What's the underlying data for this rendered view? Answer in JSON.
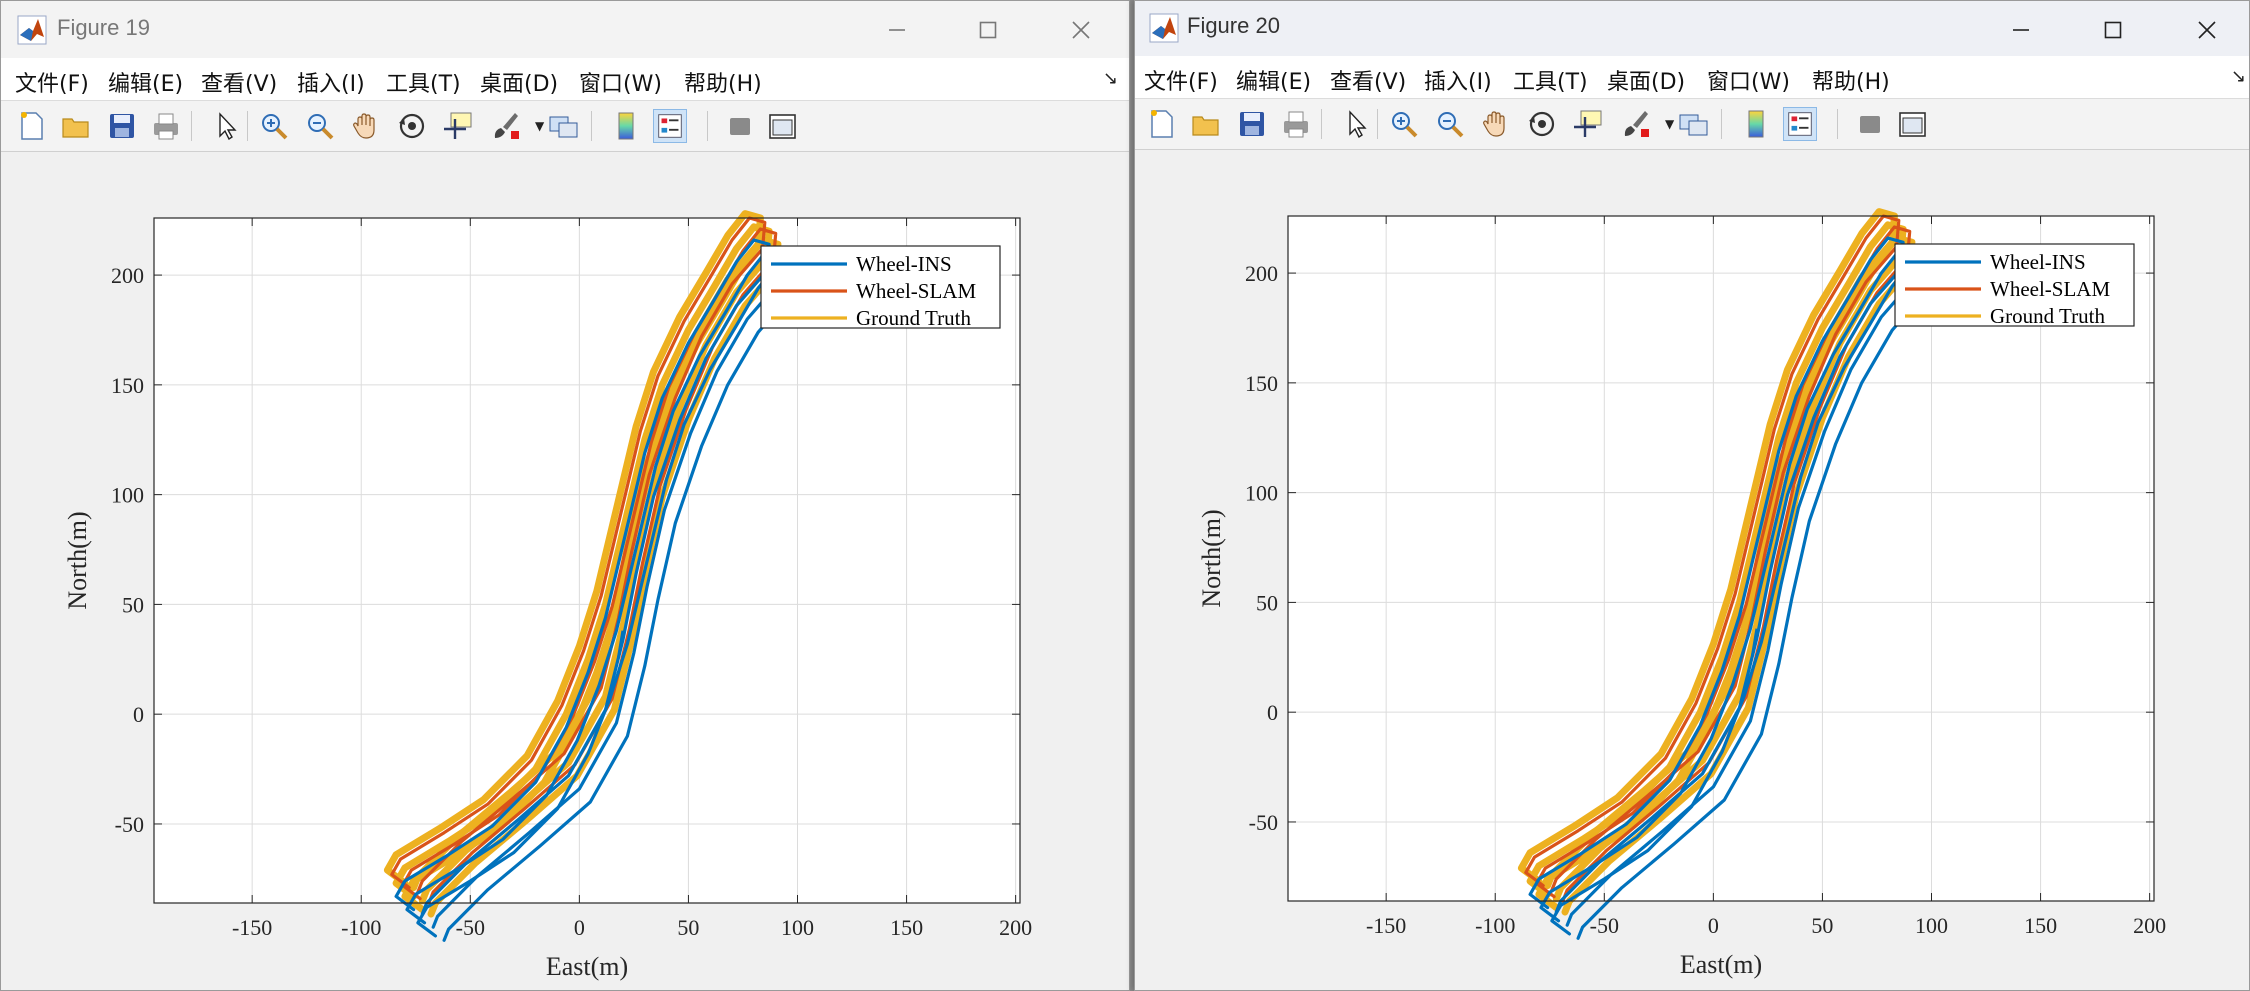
{
  "windows": [
    {
      "title": "Figure 19",
      "menu": [
        "文件(F)",
        "编辑(E)",
        "查看(V)",
        "插入(I)",
        "工具(T)",
        "桌面(D)",
        "窗口(W)",
        "帮助(H)"
      ]
    },
    {
      "title": "Figure 20",
      "menu": [
        "文件(F)",
        "编辑(E)",
        "查看(V)",
        "插入(I)",
        "工具(T)",
        "桌面(D)",
        "窗口(W)",
        "帮助(H)"
      ]
    }
  ],
  "toolbar_icons": [
    "new-figure-icon",
    "open-file-icon",
    "save-icon",
    "print-icon",
    "pointer-icon",
    "zoom-in-icon",
    "zoom-out-icon",
    "pan-icon",
    "rotate-3d-icon",
    "data-cursor-icon",
    "brush-icon",
    "link-plot-icon",
    "colorbar-icon",
    "legend-icon",
    "hide-plot-tools-icon",
    "show-plot-tools-icon"
  ],
  "colors": {
    "wheel_ins": "#0072BD",
    "wheel_slam": "#D95319",
    "ground_truth": "#EDB120"
  },
  "chart_data": [
    {
      "type": "line",
      "title": "",
      "xlabel": "East(m)",
      "ylabel": "North(m)",
      "xlim": [
        -195,
        202
      ],
      "ylim": [
        -86,
        226
      ],
      "xticks": [
        -150,
        -100,
        -50,
        0,
        50,
        100,
        150,
        200
      ],
      "yticks": [
        -50,
        0,
        50,
        100,
        150,
        200
      ],
      "xtick_labels": [
        "-150",
        "-100",
        "-50",
        "0",
        "50",
        "100",
        "150",
        "200"
      ],
      "ytick_labels": [
        "-50",
        "0",
        "50",
        "100",
        "150",
        "200"
      ],
      "grid": true,
      "legend_position": "top-right",
      "series": [
        {
          "name": "Wheel-INS",
          "color": "#0072BD",
          "loops": [
            [
              0,
              -6
            ],
            [
              5,
              -12
            ],
            [
              10,
              -18
            ]
          ],
          "start": [
            20,
            38
          ]
        },
        {
          "name": "Wheel-SLAM",
          "color": "#D95319",
          "loops": [
            [
              -2,
              4
            ],
            [
              3,
              -1
            ]
          ],
          "start": null
        },
        {
          "name": "Ground Truth",
          "color": "#EDB120",
          "loops": [
            [
              -4,
              6
            ],
            [
              0,
              0
            ],
            [
              4,
              -6
            ]
          ],
          "start": null
        }
      ],
      "path": [
        [
          -76,
          -83
        ],
        [
          -84,
          -77
        ],
        [
          -80,
          -70
        ],
        [
          -60,
          -58
        ],
        [
          -40,
          -45
        ],
        [
          -20,
          -25
        ],
        [
          -6,
          0
        ],
        [
          4,
          25
        ],
        [
          12,
          50
        ],
        [
          18,
          75
        ],
        [
          24,
          100
        ],
        [
          30,
          125
        ],
        [
          38,
          150
        ],
        [
          50,
          175
        ],
        [
          62,
          195
        ],
        [
          72,
          212
        ],
        [
          80,
          222
        ],
        [
          87,
          220
        ],
        [
          86,
          208
        ],
        [
          72,
          192
        ],
        [
          58,
          168
        ],
        [
          46,
          140
        ],
        [
          34,
          105
        ],
        [
          26,
          70
        ],
        [
          20,
          40
        ],
        [
          12,
          8
        ],
        [
          -5,
          -22
        ],
        [
          -28,
          -42
        ],
        [
          -52,
          -62
        ],
        [
          -70,
          -80
        ],
        [
          -72,
          -85
        ]
      ]
    },
    {
      "type": "line",
      "title": "",
      "xlabel": "East(m)",
      "ylabel": "North(m)",
      "xlim": [
        -195,
        202
      ],
      "ylim": [
        -86,
        226
      ],
      "xticks": [
        -150,
        -100,
        -50,
        0,
        50,
        100,
        150,
        200
      ],
      "yticks": [
        -50,
        0,
        50,
        100,
        150,
        200
      ],
      "xtick_labels": [
        "-150",
        "-100",
        "-50",
        "0",
        "50",
        "100",
        "150",
        "200"
      ],
      "ytick_labels": [
        "-50",
        "0",
        "50",
        "100",
        "150",
        "200"
      ],
      "grid": true,
      "legend_position": "top-right",
      "series": [
        {
          "name": "Wheel-INS",
          "color": "#0072BD",
          "loops": [
            [
              0,
              -6
            ],
            [
              5,
              -12
            ],
            [
              10,
              -18
            ]
          ],
          "start": [
            20,
            38
          ]
        },
        {
          "name": "Wheel-SLAM",
          "color": "#D95319",
          "loops": [
            [
              -2,
              4
            ],
            [
              3,
              -1
            ]
          ],
          "start": null
        },
        {
          "name": "Ground Truth",
          "color": "#EDB120",
          "loops": [
            [
              -4,
              6
            ],
            [
              0,
              0
            ],
            [
              4,
              -6
            ]
          ],
          "start": null
        }
      ],
      "path": [
        [
          -76,
          -83
        ],
        [
          -84,
          -77
        ],
        [
          -80,
          -70
        ],
        [
          -60,
          -58
        ],
        [
          -40,
          -45
        ],
        [
          -20,
          -25
        ],
        [
          -6,
          0
        ],
        [
          4,
          25
        ],
        [
          12,
          50
        ],
        [
          18,
          75
        ],
        [
          24,
          100
        ],
        [
          30,
          125
        ],
        [
          38,
          150
        ],
        [
          50,
          175
        ],
        [
          62,
          195
        ],
        [
          72,
          212
        ],
        [
          80,
          222
        ],
        [
          87,
          220
        ],
        [
          86,
          208
        ],
        [
          72,
          192
        ],
        [
          58,
          168
        ],
        [
          46,
          140
        ],
        [
          34,
          105
        ],
        [
          26,
          70
        ],
        [
          20,
          40
        ],
        [
          12,
          8
        ],
        [
          -5,
          -22
        ],
        [
          -28,
          -42
        ],
        [
          -52,
          -62
        ],
        [
          -70,
          -80
        ],
        [
          -72,
          -85
        ]
      ]
    }
  ]
}
